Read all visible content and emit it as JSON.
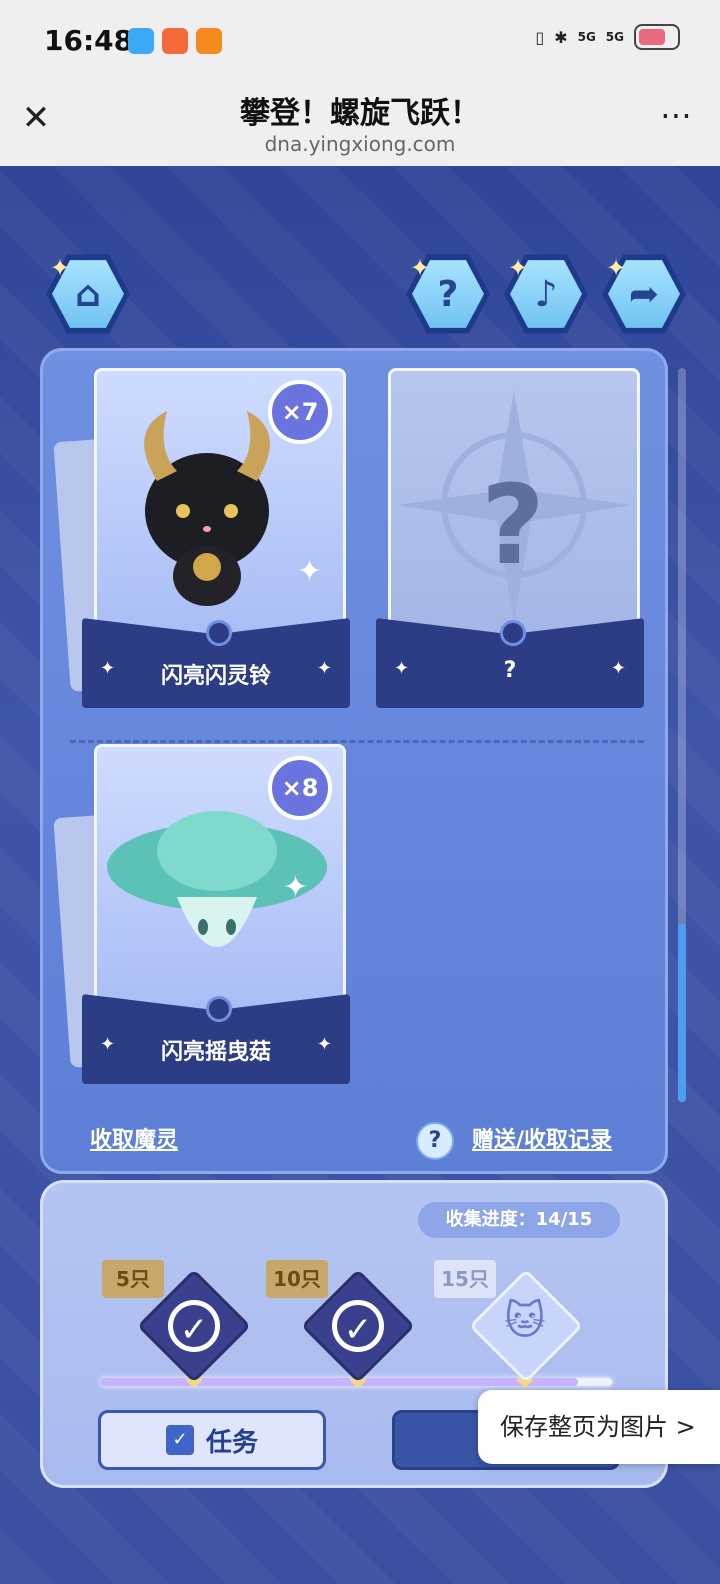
{
  "status_bar": {
    "time": "16:48",
    "network_1": "5G",
    "network_2": "5G"
  },
  "browser": {
    "title": "攀登！螺旋飞跃！",
    "url": "dna.yingxiong.com",
    "close_icon": "close-icon",
    "more_icon": "more-icon"
  },
  "top_buttons": [
    {
      "name": "home",
      "icon": "home-icon"
    },
    {
      "name": "help",
      "icon": "help-icon"
    },
    {
      "name": "music",
      "icon": "music-icon"
    },
    {
      "name": "share",
      "icon": "share-icon"
    }
  ],
  "cards": [
    {
      "name": "闪亮闪灵铃",
      "count": "×7",
      "unlocked": true
    },
    {
      "name": "?",
      "count": "",
      "unlocked": false,
      "placeholder": "?"
    },
    {
      "name": "闪亮摇曳菇",
      "count": "×8",
      "unlocked": true
    }
  ],
  "links": {
    "collect": "收取魔灵",
    "help_icon": "?",
    "record": "赠送/收取记录"
  },
  "progress": {
    "label": "收集进度：",
    "value": "14/15",
    "current": 14,
    "total": 15
  },
  "milestones": [
    {
      "label": "5只",
      "done": true
    },
    {
      "label": "10只",
      "done": true
    },
    {
      "label": "15只",
      "done": false
    }
  ],
  "buttons": {
    "task": "任务",
    "task_icon": "✓"
  },
  "save_popup": "保存整页为图片 >",
  "colors": {
    "accent": "#3c57ad",
    "page_bg": "#3a4fa0",
    "panel": "#6f8fe0"
  }
}
